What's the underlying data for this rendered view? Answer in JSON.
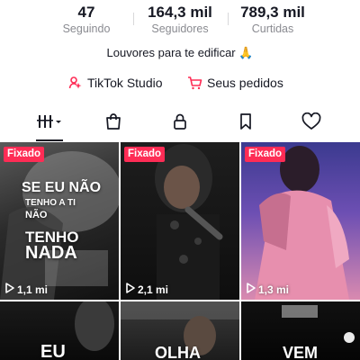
{
  "profile": {
    "stats": [
      {
        "value": "47",
        "label": "Seguindo"
      },
      {
        "value": "164,3 mil",
        "label": "Seguidores"
      },
      {
        "value": "789,3 mil",
        "label": "Curtidas"
      }
    ],
    "bio": "Louvores para te edificar 🙏",
    "links": {
      "studio": "TikTok Studio",
      "orders": "Seus pedidos"
    }
  },
  "tabs": [
    {
      "icon": "grid-icon",
      "active": true
    },
    {
      "icon": "shop-bag-icon"
    },
    {
      "icon": "lock-icon"
    },
    {
      "icon": "bookmark-icon"
    },
    {
      "icon": "heart-icon"
    }
  ],
  "videos": [
    {
      "badge": "Fixado",
      "views": "1,1 mi",
      "overlay": [
        "SE EU NÃO",
        "TENHO A TI",
        "NÃO",
        "TENHO",
        "NADA"
      ]
    },
    {
      "badge": "Fixado",
      "views": "2,1 mi",
      "overlay": []
    },
    {
      "badge": "Fixado",
      "views": "1,3 mi",
      "overlay": []
    },
    {
      "badge": "",
      "views": "",
      "overlay": [
        "EU"
      ]
    },
    {
      "badge": "",
      "views": "",
      "overlay": [
        "OLHA"
      ]
    },
    {
      "badge": "",
      "views": "",
      "overlay": [
        "VEM"
      ]
    }
  ],
  "colors": {
    "badge": "#fe2c55",
    "text": "#161823",
    "muted": "#8a8b91",
    "studio_icon": "#fe2c55"
  }
}
